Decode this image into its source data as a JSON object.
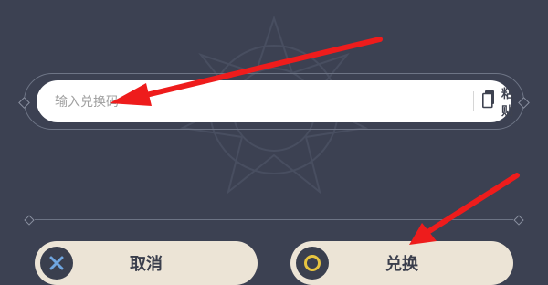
{
  "redeem_dialog": {
    "code_input": {
      "value": "",
      "placeholder": "输入兑换码"
    },
    "paste_button": {
      "label": "粘贴",
      "icon": "clipboard-icon"
    },
    "cancel_button": {
      "label": "取消",
      "icon": "x-button-icon"
    },
    "confirm_button": {
      "label": "兑换",
      "icon": "circle-button-icon"
    }
  },
  "annotations": {
    "arrow_color": "#ee1c1c",
    "arrows": [
      "arrow-to-code-input",
      "arrow-to-confirm-button"
    ]
  },
  "colors": {
    "background": "#3c4152",
    "button_fill": "#ece4d6",
    "input_fill": "#ffffff",
    "cancel_icon_accent": "#6fa6e0",
    "confirm_icon_accent": "#e7c440"
  }
}
